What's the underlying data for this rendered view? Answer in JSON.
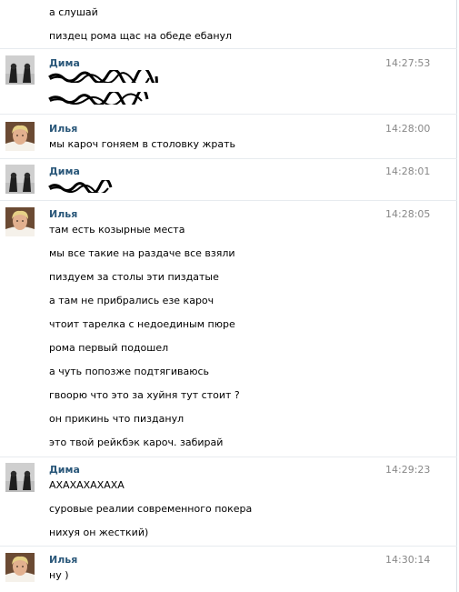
{
  "messages": [
    {
      "type": "cont",
      "text": "а слушай"
    },
    {
      "type": "cont",
      "text": "пиздец рома щас на обеде ебанул"
    },
    {
      "type": "group",
      "author": "Дима",
      "time": "14:27:53",
      "avatar": "dima-avatar"
    },
    {
      "type": "group",
      "author": "Илья",
      "time": "14:28:00",
      "avatar": "ilya-avatar",
      "text": "мы кароч гоняем в столовку жрать"
    },
    {
      "type": "group",
      "author": "Дима",
      "time": "14:28:01",
      "avatar": "dima-avatar"
    },
    {
      "type": "group",
      "author": "Илья",
      "time": "14:28:05",
      "avatar": "ilya-avatar",
      "text": "там есть козырные места"
    },
    {
      "type": "cont",
      "text": "мы все такие на раздаче все взяли"
    },
    {
      "type": "cont",
      "text": "пиздуем за столы эти пиздатые"
    },
    {
      "type": "cont",
      "text": "а там не прибрались езе кароч"
    },
    {
      "type": "cont",
      "text": "чтоит тарелка с недоединым пюре"
    },
    {
      "type": "cont",
      "text": "рома первый подошел"
    },
    {
      "type": "cont",
      "text": "а чуть попозже подтягиваюсь"
    },
    {
      "type": "cont",
      "text": "гвоорю что это за хуйня тут стоит ?"
    },
    {
      "type": "cont",
      "text": "он прикинь что пизданул"
    },
    {
      "type": "cont",
      "text": "это твой рейкбэк кароч. забирай"
    },
    {
      "type": "group",
      "author": "Дима",
      "time": "14:29:23",
      "avatar": "dima-avatar",
      "text": "АХАХАХАХАХА"
    },
    {
      "type": "cont",
      "text": "суровые реалии современного покера"
    },
    {
      "type": "cont",
      "text": "нихуя он жесткий)"
    },
    {
      "type": "group",
      "author": "Илья",
      "time": "14:30:14",
      "avatar": "ilya-avatar",
      "text": "ну )"
    }
  ]
}
